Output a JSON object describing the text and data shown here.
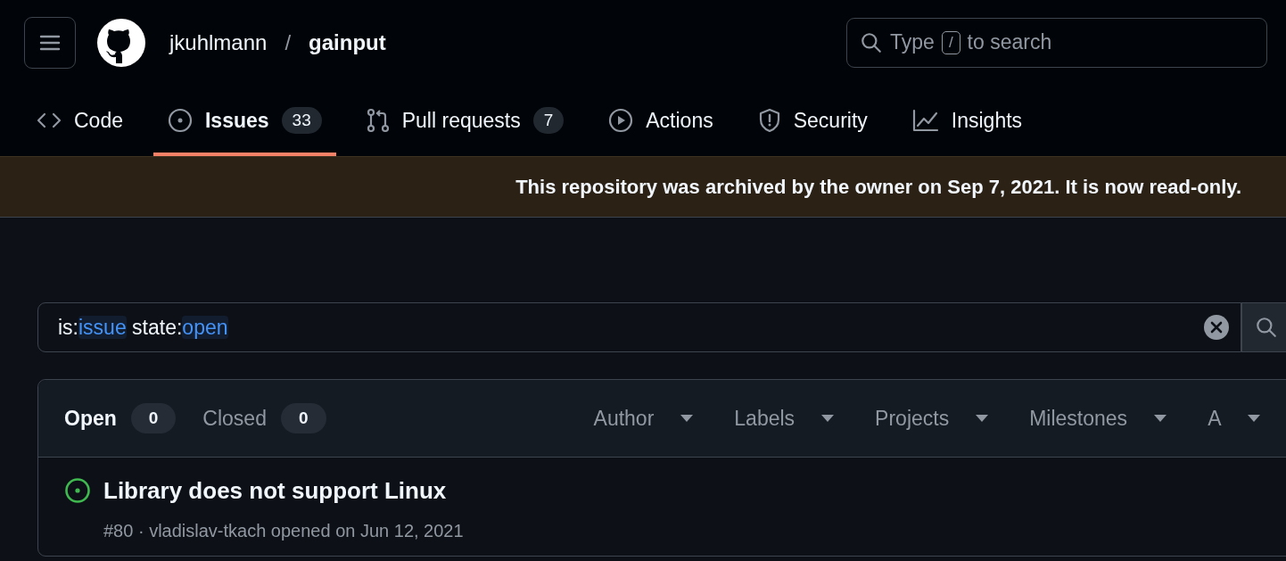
{
  "header": {
    "owner": "jkuhlmann",
    "separator": "/",
    "repo": "gainput",
    "search": {
      "placeholder_before": "Type",
      "key": "/",
      "placeholder_after": "to search"
    }
  },
  "tabs": [
    {
      "label": "Code",
      "selected": false
    },
    {
      "label": "Issues",
      "count": "33",
      "selected": true
    },
    {
      "label": "Pull requests",
      "count": "7",
      "selected": false
    },
    {
      "label": "Actions",
      "selected": false
    },
    {
      "label": "Security",
      "selected": false
    },
    {
      "label": "Insights",
      "selected": false
    }
  ],
  "banner": "This repository was archived by the owner on Sep 7, 2021. It is now read-only.",
  "query": [
    {
      "key": "is:",
      "value": "issue"
    },
    {
      "key": "state:",
      "value": "open"
    }
  ],
  "state_tabs": [
    {
      "label": "Open",
      "count": "0",
      "selected": true
    },
    {
      "label": "Closed",
      "count": "0",
      "selected": false
    }
  ],
  "filters": [
    "Author",
    "Labels",
    "Projects",
    "Milestones",
    "A"
  ],
  "issues": [
    {
      "kind": "open",
      "title": "Library does not support Linux",
      "meta": "#80 · vladislav-tkach opened on Jun 12, 2021"
    }
  ]
}
